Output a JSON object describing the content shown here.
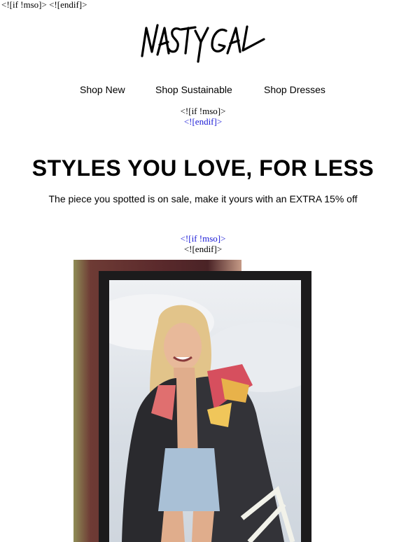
{
  "preheader": {
    "text": "<![if !mso]> <![endif]>"
  },
  "brand": {
    "name": "NASTY GAL"
  },
  "nav": {
    "items": [
      {
        "label": "Shop New"
      },
      {
        "label": "Shop Sustainable"
      },
      {
        "label": "Shop Dresses"
      }
    ]
  },
  "conditional_1": {
    "line1": "<![if !mso]>",
    "line2": "<![endif]>"
  },
  "hero": {
    "headline": "STYLES YOU LOVE, FOR LESS",
    "subtext": "The piece you spotted is on sale, make it yours with an EXTRA 15% off"
  },
  "conditional_2": {
    "line1": "<![if !mso]>",
    "line2": "<![endif]>"
  },
  "image": {
    "description_icon": "model-photo"
  },
  "colors": {
    "link_blue": "#1a1ad6",
    "frame": "#1c1b1c"
  }
}
